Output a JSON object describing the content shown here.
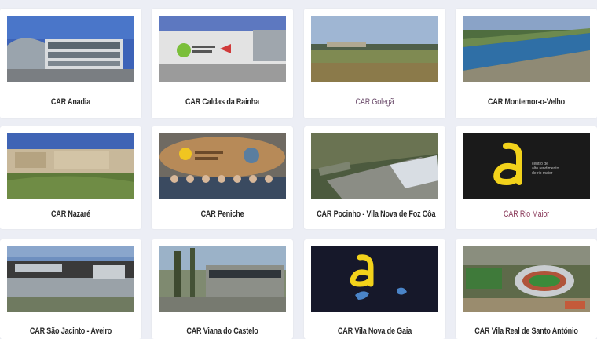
{
  "centers": [
    {
      "name": "CAR Anadia",
      "icon": "building-photo"
    },
    {
      "name": "CAR Caldas da Rainha",
      "icon": "building-logo-photo"
    },
    {
      "name": "CAR Golegã",
      "icon": "field-photo"
    },
    {
      "name": "CAR Montemor-o-Velho",
      "icon": "rowing-channel-photo"
    },
    {
      "name": "CAR Nazaré",
      "icon": "building-lawn-photo"
    },
    {
      "name": "CAR Peniche",
      "icon": "group-photo"
    },
    {
      "name": "CAR Pocinho - Vila Nova de Foz Côa",
      "icon": "aerial-photo"
    },
    {
      "name": "CAR Rio Maior",
      "icon": "logo-image"
    },
    {
      "name": "CAR São Jacinto - Aveiro",
      "icon": "building-photo"
    },
    {
      "name": "CAR Viana do Castelo",
      "icon": "building-trees-photo"
    },
    {
      "name": "CAR Vila Nova de Gaia",
      "icon": "logo-image"
    },
    {
      "name": "CAR Vila Real de Santo António",
      "icon": "stadium-aerial-photo"
    }
  ],
  "logo_text": {
    "rio_maior": [
      "centro de",
      "alto rendimento",
      "de rio maior"
    ]
  },
  "colors": {
    "background": "#eceef5",
    "card": "#ffffff",
    "logo_yellow": "#f2d21b"
  }
}
